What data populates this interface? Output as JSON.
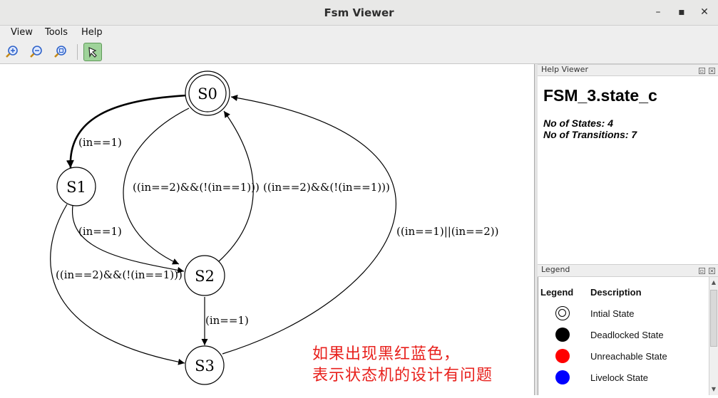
{
  "window": {
    "title": "Fsm Viewer",
    "minimize": "–",
    "maximize": "▪",
    "close": "✕"
  },
  "menu": {
    "view": "View",
    "tools": "Tools",
    "help": "Help"
  },
  "toolbar": {
    "buttons": [
      "zoom-in-icon",
      "zoom-out-icon",
      "zoom-fit-icon",
      "select-tool-icon"
    ]
  },
  "diagram": {
    "states": {
      "s0": "S0",
      "s1": "S1",
      "s2": "S2",
      "s3": "S3"
    },
    "transitions": {
      "s0_s1": "(in==1)",
      "s0_s2": "((in==2)&&(!(in==1)))",
      "s2_s0": "((in==2)&&(!(in==1)))",
      "s1_s2": "(in==1)",
      "s1_s3": "((in==2)&&(!(in==1)))",
      "s2_s3": "(in==1)",
      "s3_s0": "((in==1)||(in==2))"
    },
    "annotation": {
      "line1": "如果出现黑红蓝色，",
      "line2": "表示状态机的设计有问题"
    }
  },
  "help_viewer": {
    "panel_title": "Help Viewer",
    "fsm_name": "FSM_3.state_c",
    "states_line": "No of States: 4",
    "transitions_line": "No of Transitions: 7"
  },
  "legend": {
    "panel_title": "Legend",
    "col_legend": "Legend",
    "col_description": "Description",
    "items": [
      {
        "label": "Intial State",
        "color": "#ffffff"
      },
      {
        "label": "Deadlocked State",
        "color": "#000000"
      },
      {
        "label": "Unreachable State",
        "color": "#ff0000"
      },
      {
        "label": "Livelock State",
        "color": "#0000ff"
      }
    ]
  }
}
